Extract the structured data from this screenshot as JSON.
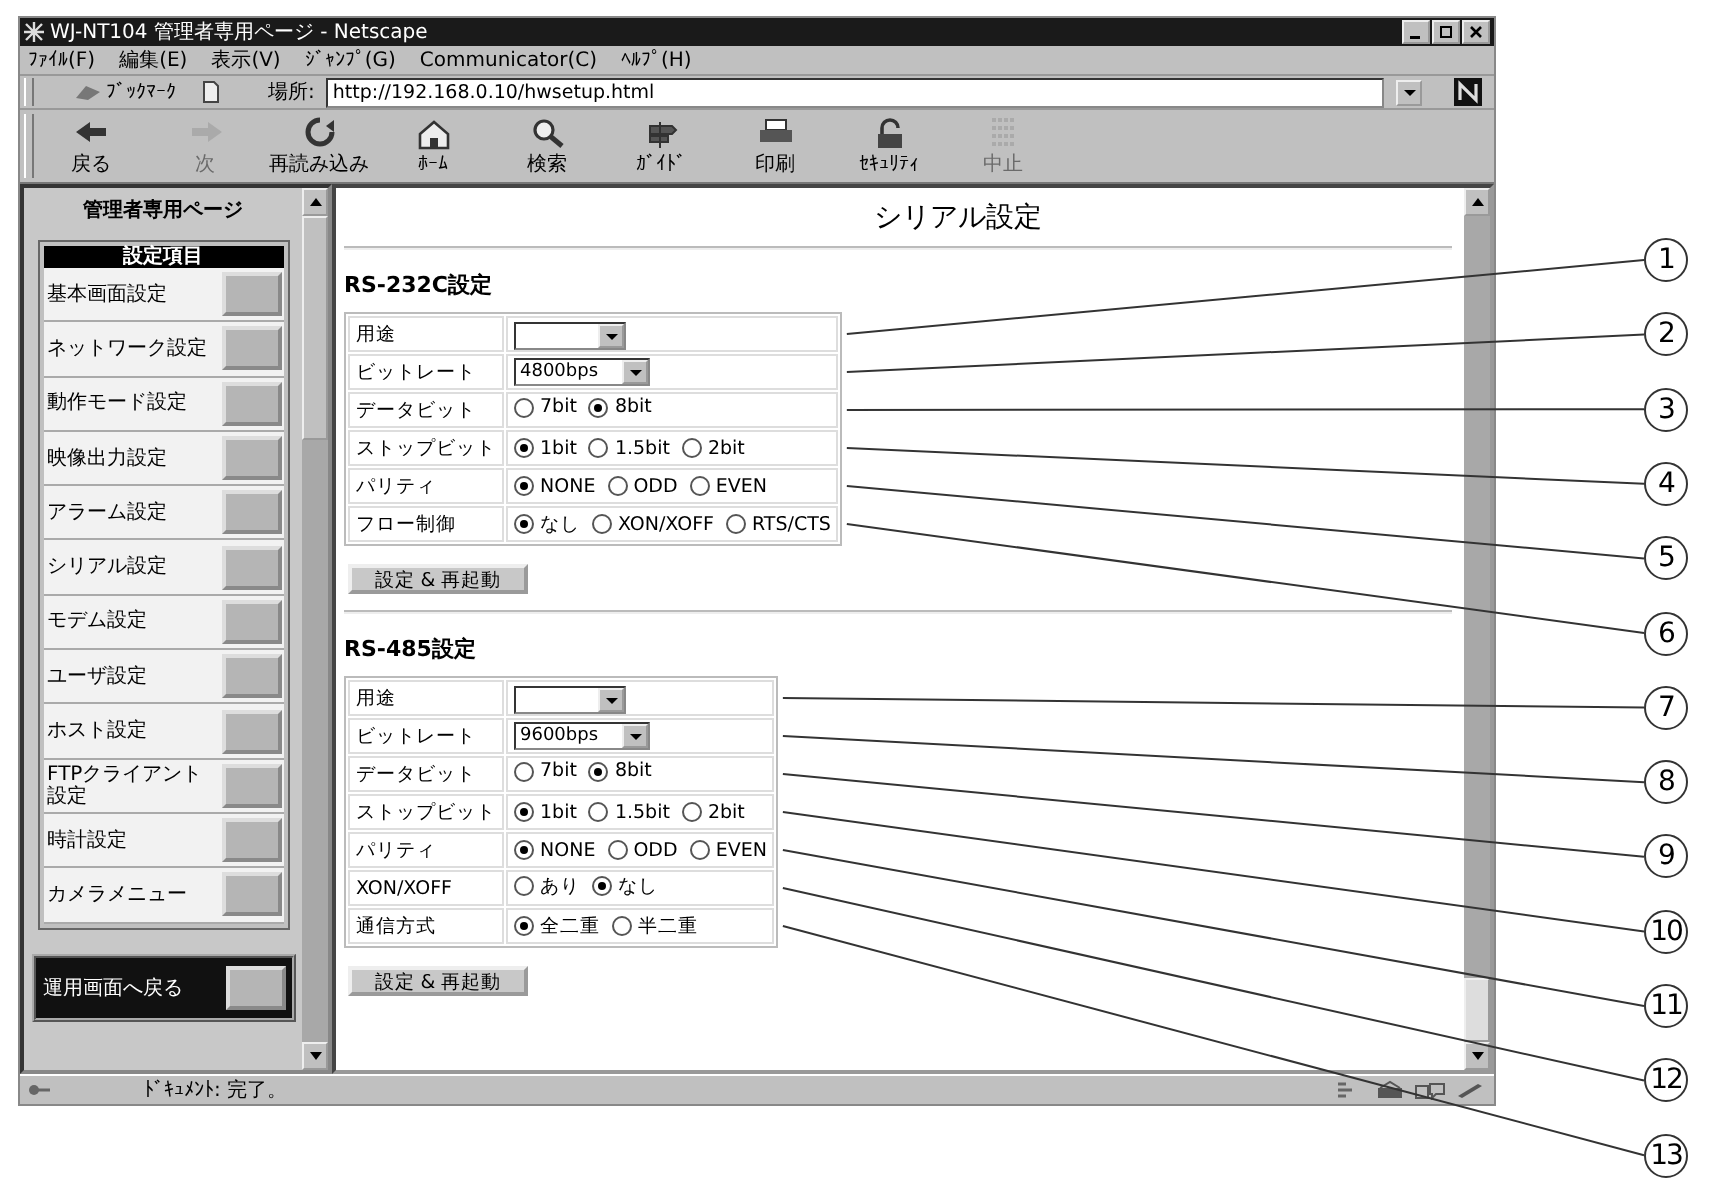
{
  "window": {
    "title": "WJ-NT104 管理者専用ページ - Netscape"
  },
  "menu": [
    "ﾌｧｲﾙ(F)",
    "編集(E)",
    "表示(V)",
    "ｼﾞｬﾝﾌﾟ(G)",
    "Communicator(C)",
    "ﾍﾙﾌﾟ(H)"
  ],
  "location_bar": {
    "bookmarks": "ﾌﾞｯｸﾏｰｸ",
    "label": "場所:",
    "url": "http://192.168.0.10/hwsetup.html"
  },
  "toolbar": [
    {
      "label": "戻る",
      "disabled": false
    },
    {
      "label": "次",
      "disabled": true
    },
    {
      "label": "再読み込み",
      "disabled": false
    },
    {
      "label": "ﾎｰﾑ",
      "disabled": false
    },
    {
      "label": "検索",
      "disabled": false
    },
    {
      "label": "ｶﾞｲﾄﾞ",
      "disabled": false
    },
    {
      "label": "印刷",
      "disabled": false
    },
    {
      "label": "ｾｷｭﾘﾃｨ",
      "disabled": false
    },
    {
      "label": "中止",
      "disabled": true
    }
  ],
  "sidebar": {
    "title": "管理者専用ページ",
    "menu_heading": "設定項目",
    "items": [
      "基本画面設定",
      "ネットワーク設定",
      "動作モード設定",
      "映像出力設定",
      "アラーム設定",
      "シリアル設定",
      "モデム設定",
      "ユーザ設定",
      "ホスト設定",
      "FTPクライアント設定",
      "時計設定",
      "カメラメニュー"
    ],
    "back_button": "運用画面へ戻る"
  },
  "page_title": "シリアル設定",
  "sections": [
    {
      "title": "RS-232C設定",
      "button": "設定 & 再起動",
      "rows": [
        {
          "label": "用途",
          "kind": "select",
          "callout": "1"
        },
        {
          "label": "ビットレート",
          "kind": "select",
          "value": "4800bps",
          "callout": "2"
        },
        {
          "label": "データビット",
          "kind": "radio",
          "callout": "3",
          "options": [
            {
              "label": "7bit",
              "selected": false
            },
            {
              "label": "8bit",
              "selected": true
            }
          ]
        },
        {
          "label": "ストップビット",
          "kind": "radio",
          "callout": "4",
          "options": [
            {
              "label": "1bit",
              "selected": true
            },
            {
              "label": "1.5bit",
              "selected": false
            },
            {
              "label": "2bit",
              "selected": false
            }
          ]
        },
        {
          "label": "パリティ",
          "kind": "radio",
          "callout": "5",
          "options": [
            {
              "label": "NONE",
              "selected": true
            },
            {
              "label": "ODD",
              "selected": false
            },
            {
              "label": "EVEN",
              "selected": false
            }
          ]
        },
        {
          "label": "フロー制御",
          "kind": "radio",
          "callout": "6",
          "options": [
            {
              "label": "なし",
              "selected": true
            },
            {
              "label": "XON/XOFF",
              "selected": false
            },
            {
              "label": "RTS/CTS",
              "selected": false
            }
          ]
        }
      ]
    },
    {
      "title": "RS-485設定",
      "button": "設定 & 再起動",
      "rows": [
        {
          "label": "用途",
          "kind": "select",
          "callout": "7"
        },
        {
          "label": "ビットレート",
          "kind": "select",
          "value": "9600bps",
          "callout": "8"
        },
        {
          "label": "データビット",
          "kind": "radio",
          "callout": "9",
          "options": [
            {
              "label": "7bit",
              "selected": false
            },
            {
              "label": "8bit",
              "selected": true
            }
          ]
        },
        {
          "label": "ストップビット",
          "kind": "radio",
          "callout": "10",
          "options": [
            {
              "label": "1bit",
              "selected": true
            },
            {
              "label": "1.5bit",
              "selected": false
            },
            {
              "label": "2bit",
              "selected": false
            }
          ]
        },
        {
          "label": "パリティ",
          "kind": "radio",
          "callout": "11",
          "options": [
            {
              "label": "NONE",
              "selected": true
            },
            {
              "label": "ODD",
              "selected": false
            },
            {
              "label": "EVEN",
              "selected": false
            }
          ]
        },
        {
          "label": "XON/XOFF",
          "kind": "radio",
          "callout": "12",
          "options": [
            {
              "label": "あり",
              "selected": false
            },
            {
              "label": "なし",
              "selected": true
            }
          ]
        },
        {
          "label": "通信方式",
          "kind": "radio",
          "callout": "13",
          "options": [
            {
              "label": "全二重",
              "selected": true
            },
            {
              "label": "半二重",
              "selected": false
            }
          ]
        }
      ]
    }
  ],
  "status_bar": "ﾄﾞｷｭﾒﾝﾄ: 完了。"
}
